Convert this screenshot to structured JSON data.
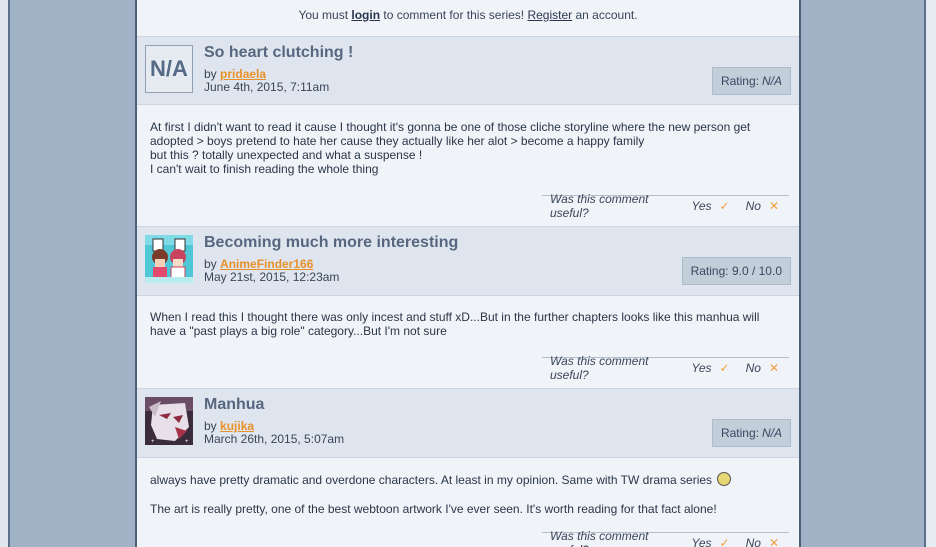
{
  "notice": {
    "prefix": "You must",
    "login": "login",
    "middle": "to comment for this series!",
    "register": "Register",
    "suffix": "an account."
  },
  "comments": [
    {
      "avatar_text": "N/A",
      "title": "So heart clutching !",
      "by": "by",
      "author": "pridaela",
      "date": "June 4th, 2015, 7:11am",
      "rating_label": "Rating:",
      "rating_value": "N/A",
      "body": [
        "At first I didn't want to read it cause I thought it's gonna be one of those cliche storyline where the new person get adopted > boys pretend to hate her cause they actually like her alot > become a happy family",
        "but this ? totally unexpected and what a suspense !",
        "I can't wait to finish reading the whole thing"
      ],
      "useful_q": "Was this comment useful?",
      "yes": "Yes",
      "no": "No"
    },
    {
      "title": "Becoming much more interesting",
      "by": "by",
      "author": "AnimeFinder166",
      "date": "May 21st, 2015, 12:23am",
      "rating": "Rating: 9.0 / 10.0",
      "body": [
        "When I read this I thought there was only incest and stuff xD...But in the further chapters looks like this manhua will have a \"past plays a big role\" category...But I'm not sure"
      ],
      "useful_q": "Was this comment useful?",
      "yes": "Yes",
      "no": "No"
    },
    {
      "title": "Manhua",
      "by": "by",
      "author": "kujika",
      "date": "March 26th, 2015, 5:07am",
      "rating_label": "Rating:",
      "rating_value": "N/A",
      "body": [
        "always have pretty dramatic and overdone characters. At least in my opinion. Same with TW drama series",
        "The art is really pretty, one of the best webtoon artwork I've ever seen. It's worth reading for that fact alone!"
      ],
      "useful_q": "Was this comment useful?",
      "yes": "Yes",
      "no": "No"
    }
  ]
}
